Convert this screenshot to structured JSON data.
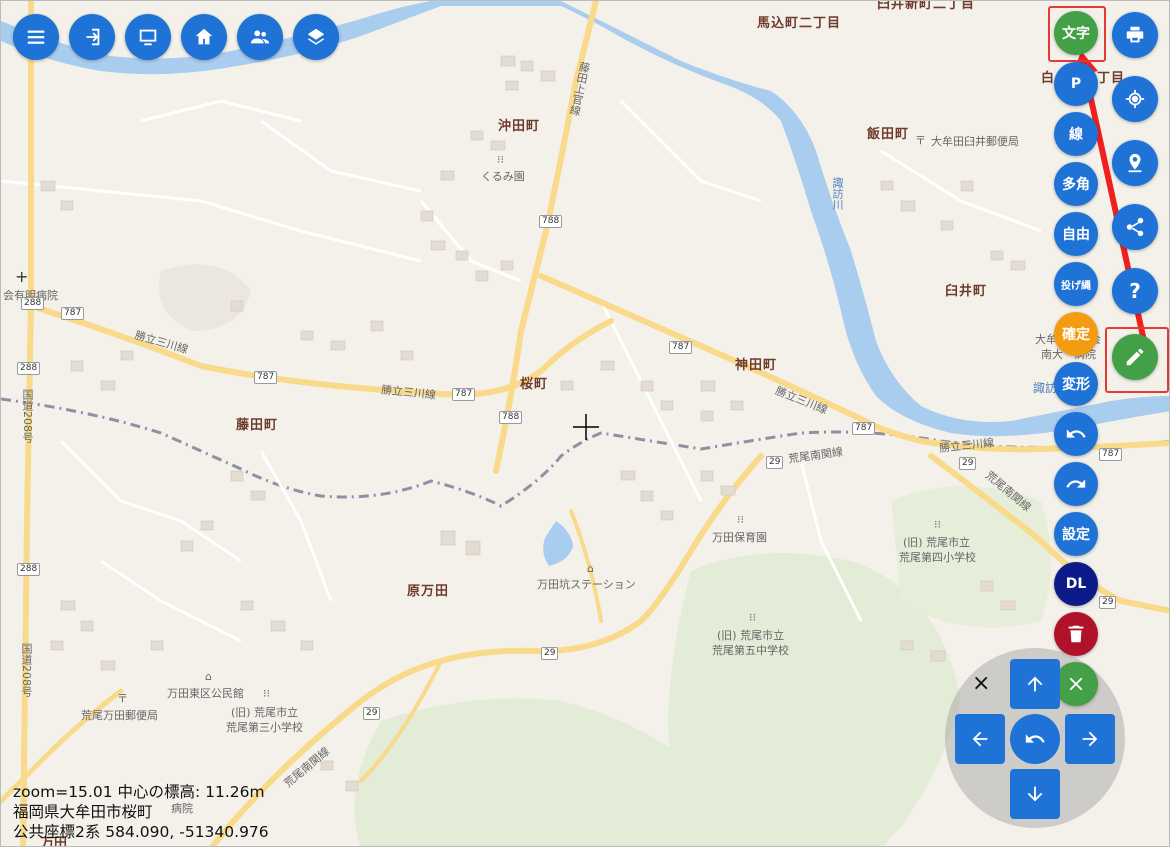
{
  "toolbar_left": [
    {
      "name": "menu-icon"
    },
    {
      "name": "login-icon"
    },
    {
      "name": "monitor-icon"
    },
    {
      "name": "home-icon"
    },
    {
      "name": "people-icon"
    },
    {
      "name": "layers-icon"
    }
  ],
  "toolbar_right": {
    "text_tool": "文字",
    "print": "print-icon",
    "locate": "locate-icon",
    "pin": "pin-icon",
    "share": "share-icon",
    "help": "help-icon",
    "edit": "pencil-icon"
  },
  "draw_menu": {
    "point": "P",
    "line": "線",
    "polygon": "多角",
    "freehand": "自由",
    "lasso": "投げ縄",
    "confirm": "確定",
    "transform": "変形",
    "undo": "undo-icon",
    "redo": "redo-icon",
    "settings": "設定",
    "download": "DL",
    "delete": "trash-icon",
    "close": "close-icon"
  },
  "nav_pad": {
    "close": "×",
    "up": "arrow-up-icon",
    "down": "arrow-down-icon",
    "left": "arrow-left-icon",
    "right": "arrow-right-icon",
    "reset": "rotate-icon"
  },
  "map": {
    "places": [
      {
        "id": "mag2",
        "text": "馬込町二丁目"
      },
      {
        "id": "okita",
        "text": "沖田町"
      },
      {
        "id": "iida",
        "text": "飯田町"
      },
      {
        "id": "kanda",
        "text": "神田町"
      },
      {
        "id": "usui",
        "text": "臼井町"
      },
      {
        "id": "sakura",
        "text": "桜町"
      },
      {
        "id": "fujita",
        "text": "藤田町"
      },
      {
        "id": "haramanda",
        "text": "原万田"
      },
      {
        "id": "usui-shin",
        "text": "臼井新町二丁目"
      },
      {
        "id": "usui2",
        "text": "白　町二丁目"
      }
    ],
    "pois": [
      {
        "id": "kurumi",
        "text": "くるみ園"
      },
      {
        "id": "post-omuta",
        "text": "大牟田臼井郵便局"
      },
      {
        "id": "hospital-left",
        "text": "会有明病院"
      },
      {
        "id": "hospital-right1",
        "text": "大牟　　協会"
      },
      {
        "id": "hospital-right2",
        "text": "南大　病院"
      },
      {
        "id": "manda-hoiku",
        "text": "万田保育園"
      },
      {
        "id": "arao4-1",
        "text": "(旧) 荒尾市立"
      },
      {
        "id": "arao4-2",
        "text": "荒尾第四小学校"
      },
      {
        "id": "manda-station",
        "text": "万田坑ステーション"
      },
      {
        "id": "arao5-1",
        "text": "(旧) 荒尾市立"
      },
      {
        "id": "arao5-2",
        "text": "荒尾第五中学校"
      },
      {
        "id": "manda-higashi",
        "text": "万田東区公民館"
      },
      {
        "id": "arao3-1",
        "text": "(旧) 荒尾市立"
      },
      {
        "id": "arao3-2",
        "text": "荒尾第三小学校"
      },
      {
        "id": "arao-post",
        "text": "荒尾万田郵便局"
      },
      {
        "id": "byoin-bottom",
        "text": "病院"
      },
      {
        "id": "manda-bottom",
        "text": "万田"
      }
    ],
    "roads": [
      {
        "id": "katsu1",
        "text": "勝立三川線"
      },
      {
        "id": "katsu2",
        "text": "勝立三川線"
      },
      {
        "id": "katsu3",
        "text": "勝立三川線"
      },
      {
        "id": "katsu4",
        "text": "勝立三川線"
      },
      {
        "id": "arao-minami1",
        "text": "荒尾南関線"
      },
      {
        "id": "arao-minami2",
        "text": "荒尾南関線"
      },
      {
        "id": "arao-minami3",
        "text": "荒尾南関線"
      },
      {
        "id": "fujita-kami",
        "text": "藤田上官線"
      },
      {
        "id": "kokudo1",
        "text": "国道208号"
      },
      {
        "id": "kokudo2",
        "text": "国道208号"
      },
      {
        "id": "suwa1",
        "text": "諏訪川"
      },
      {
        "id": "suwa2",
        "text": "諏訪川"
      }
    ],
    "shields": [
      "288",
      "787",
      "288",
      "787",
      "787",
      "788",
      "788",
      "787",
      "787",
      "29",
      "29",
      "288",
      "29",
      "29",
      "787",
      "29"
    ]
  },
  "info": {
    "line1": "zoom=15.01 中心の標高: 11.26m",
    "line2": "福岡県大牟田市桜町",
    "line3": "公共座標2系 584.090, -51340.976"
  },
  "colors": {
    "button_blue": "#1f72d6",
    "text_green": "#43a047",
    "confirm_orange": "#f39c12",
    "dl_navy": "#0d1a8a",
    "trash_red": "#b0122a",
    "highlight_red": "#e53935"
  }
}
